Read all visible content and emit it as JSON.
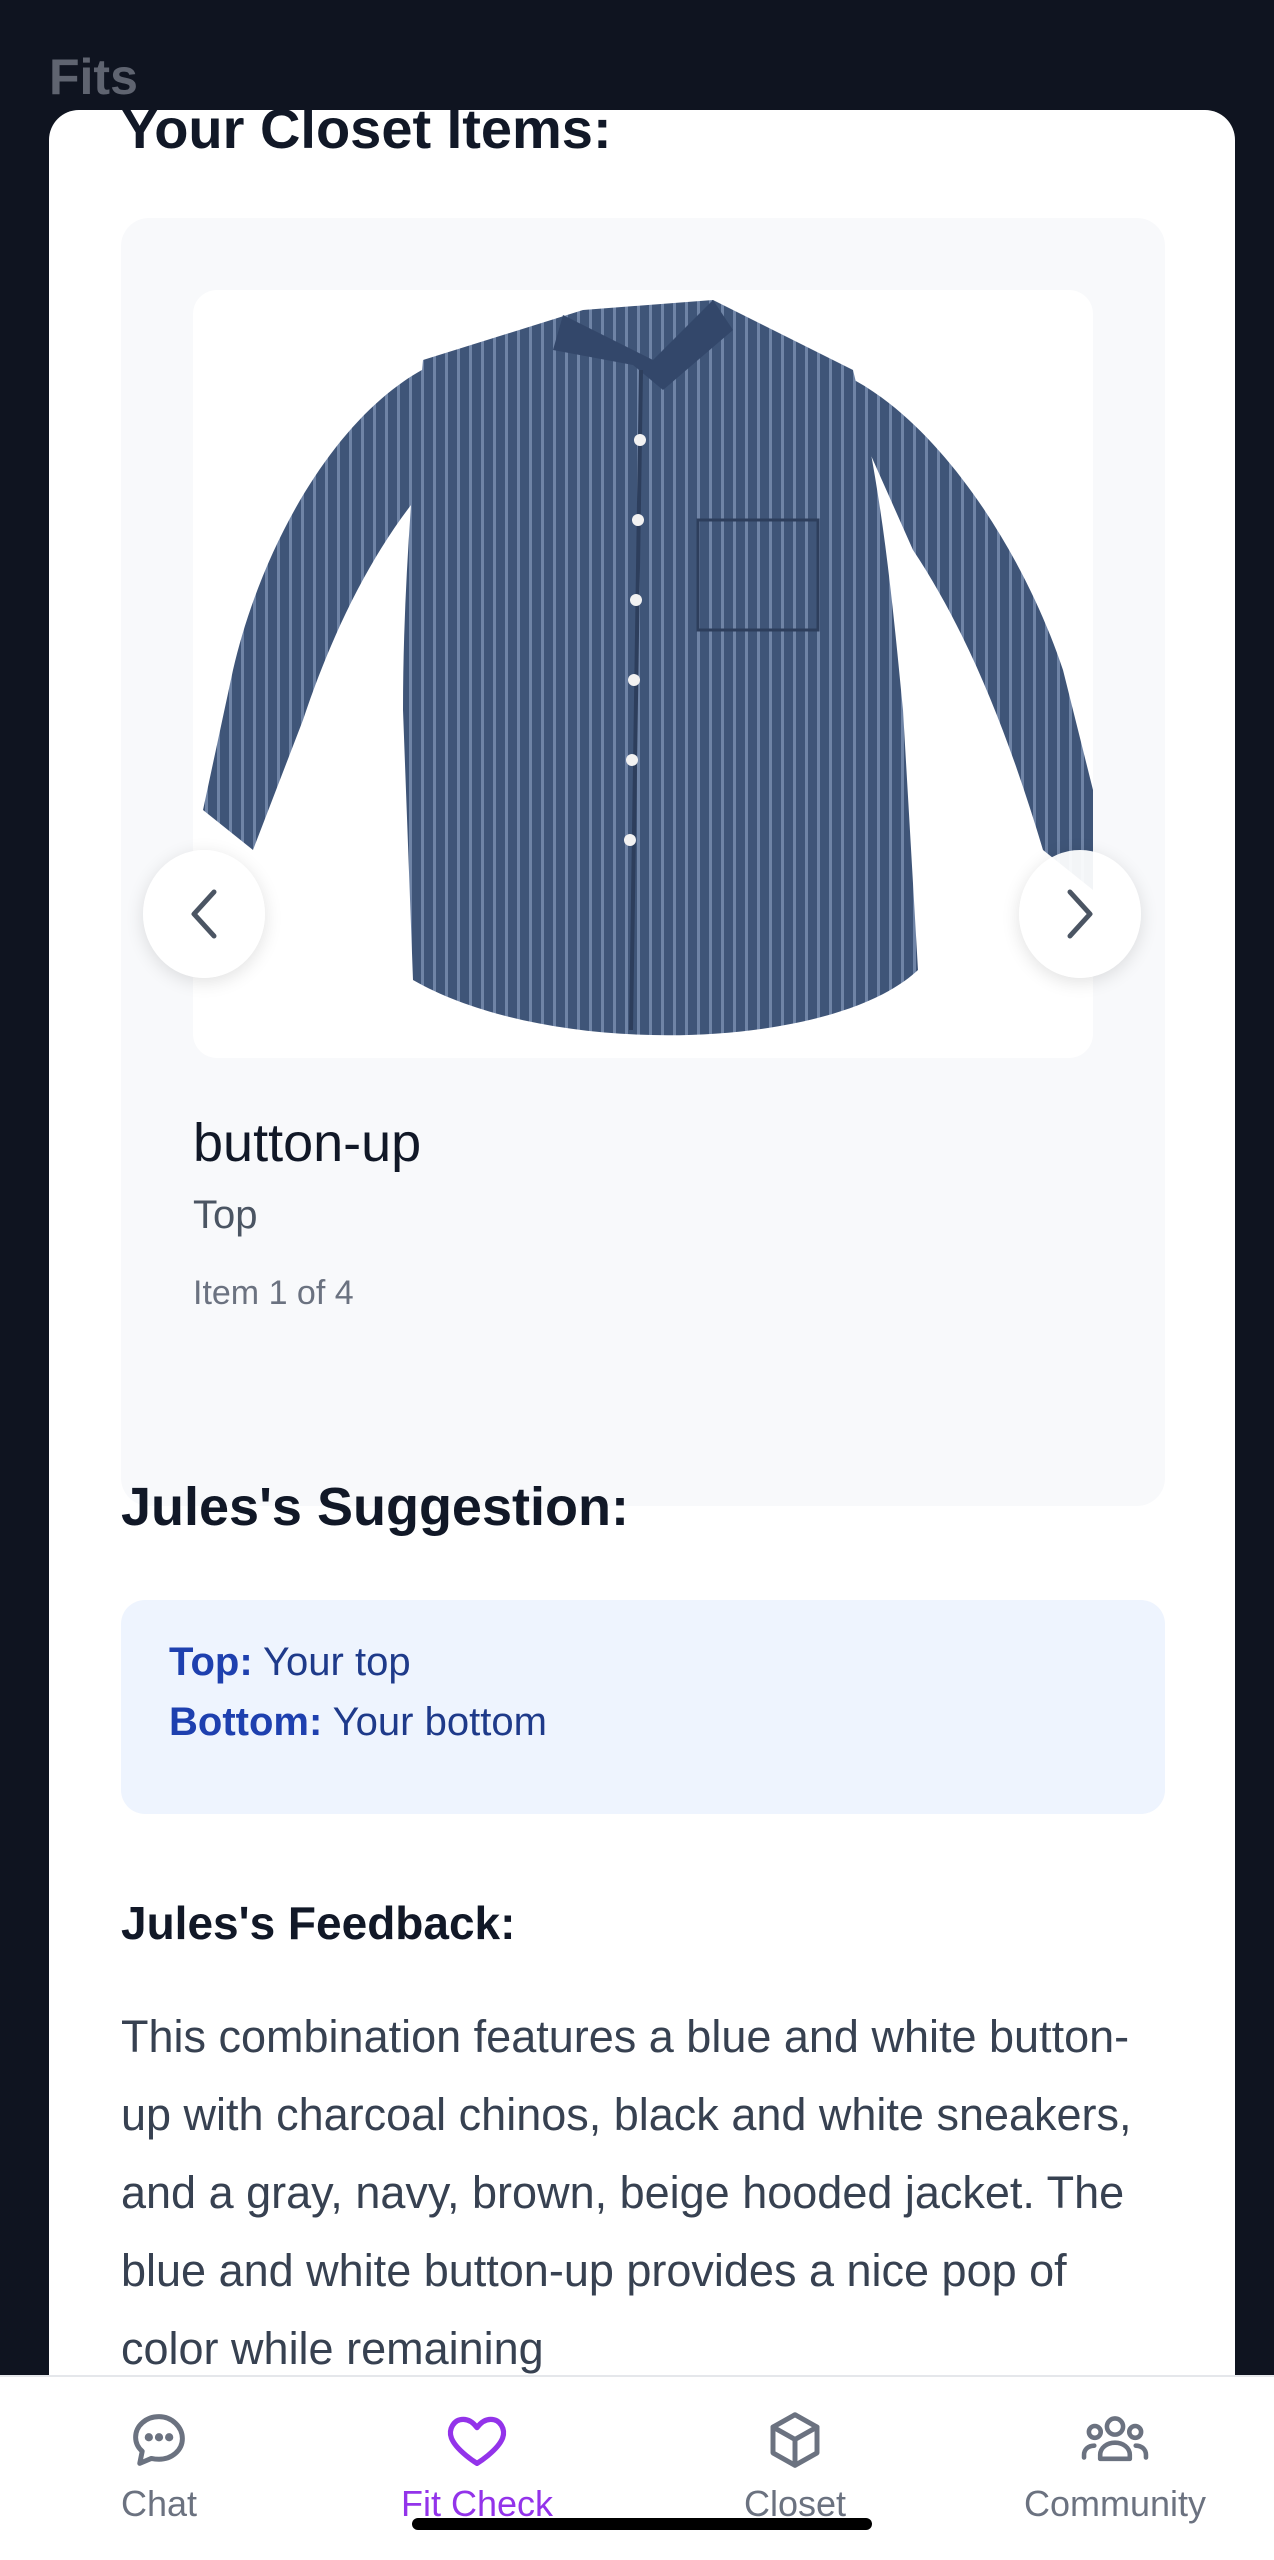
{
  "app": {
    "title": "Fits"
  },
  "closet": {
    "heading": "Your Closet Items:",
    "item": {
      "name": "button-up",
      "type": "Top",
      "counter": "Item 1 of 4"
    }
  },
  "suggestion": {
    "heading": "Jules's Suggestion:",
    "top_label": "Top:",
    "top_value": "Your top",
    "bottom_label": "Bottom:",
    "bottom_value": "Your bottom"
  },
  "feedback": {
    "heading": "Jules's Feedback:",
    "text": "This combination features a blue and white button-up with charcoal chinos, black and white sneakers, and a gray, navy, brown, beige hooded jacket. The blue and white button-up provides a nice pop of color while remaining"
  },
  "tabs": [
    {
      "label": "Chat",
      "icon": "chat-bubble-icon",
      "active": false
    },
    {
      "label": "Fit Check",
      "icon": "heart-icon",
      "active": true
    },
    {
      "label": "Closet",
      "icon": "box-icon",
      "active": false
    },
    {
      "label": "Community",
      "icon": "people-icon",
      "active": false
    }
  ],
  "colors": {
    "accent": "#9333ea",
    "suggestion_bg": "#eef4fe",
    "suggestion_text": "#1e40af"
  }
}
